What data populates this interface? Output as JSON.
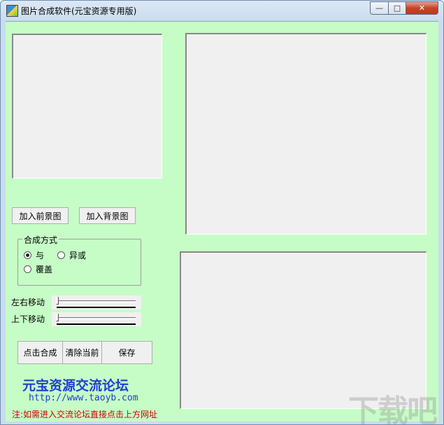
{
  "window": {
    "title": "图片合成软件(元宝资源专用版)",
    "controls": {
      "minimize": "—",
      "maximize": "□",
      "close": "✕"
    }
  },
  "buttons": {
    "add_foreground": "加入前景图",
    "add_background": "加入背景图",
    "compose": "点击合成",
    "clear": "清除当前",
    "save": "保存"
  },
  "blend_mode": {
    "title": "合成方式",
    "options": [
      {
        "label": "与",
        "checked": true
      },
      {
        "label": "异或",
        "checked": false
      },
      {
        "label": "覆盖",
        "checked": false
      }
    ]
  },
  "sliders": {
    "horizontal_label": "左右移动",
    "vertical_label": "上下移动",
    "horizontal_value": 0,
    "vertical_value": 0
  },
  "footer": {
    "forum_name": "元宝资源交流论坛",
    "url": "http://www.taoyb.com",
    "note": "注:如需进入交流论坛直接点击上方网址"
  },
  "watermark": "下载吧",
  "colors": {
    "client_background": "#c6fdc6",
    "link_blue": "#1f3fd0",
    "note_red": "#d00000"
  }
}
